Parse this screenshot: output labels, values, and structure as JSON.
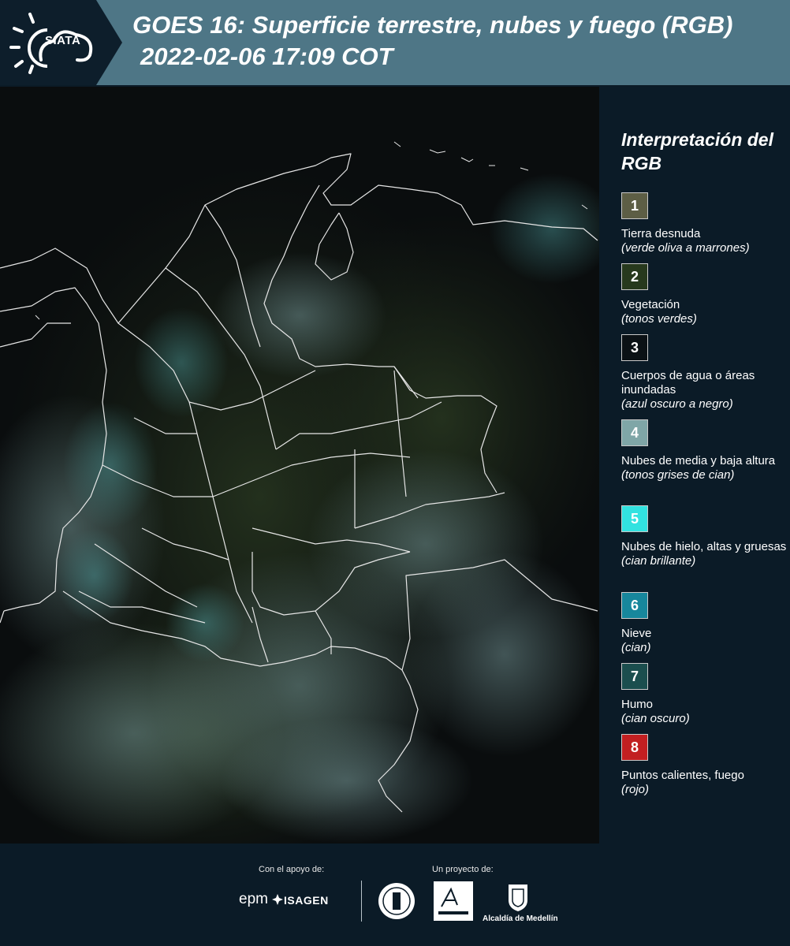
{
  "header": {
    "logo_text": "SIATA",
    "title": "GOES 16: Superficie terrestre, nubes y fuego (RGB)",
    "subtitle": "2022-02-06 17:09 COT",
    "colors": {
      "bar": "#4e7686",
      "logo_block": "#0d1e2b"
    }
  },
  "map": {
    "description_icon": "satellite-rgb-map",
    "colors": {
      "background": "#0a0d0e",
      "vegetation": "#1c2a1a",
      "cloud": "#5a7a7c",
      "border": "#e6e6e6"
    }
  },
  "legend": {
    "title": "Interpretación del RGB",
    "items": [
      {
        "number": "1",
        "label": "Tierra desnuda",
        "desc": "(verde oliva a marrones)",
        "color": "#5d5e45"
      },
      {
        "number": "2",
        "label": "Vegetación",
        "desc": "(tonos verdes)",
        "color": "#27391d"
      },
      {
        "number": "3",
        "label": "Cuerpos de agua o áreas inundadas",
        "desc": "(azul oscuro a negro)",
        "color": "#0b1115"
      },
      {
        "number": "4",
        "label": "Nubes de media y baja altura",
        "desc": "(tonos grises de cian)",
        "color": "#7fa6a7"
      },
      {
        "number": "5",
        "label": "Nubes de hielo, altas y gruesas",
        "desc": "(cian brillante)",
        "color": "#32e2e0"
      },
      {
        "number": "6",
        "label": "Nieve",
        "desc": "(cian)",
        "color": "#17879c"
      },
      {
        "number": "7",
        "label": "Humo",
        "desc": "(cian oscuro)",
        "color": "#1b4e4e"
      },
      {
        "number": "8",
        "label": "Puntos calientes, fuego",
        "desc": "(rojo)",
        "color": "#c21f21"
      }
    ]
  },
  "footer": {
    "support_label": "Con el apoyo de:",
    "project_label": "Un proyecto de:",
    "epm": "epm",
    "isagen": "ISAGEN",
    "alcaldia": "Alcaldía de Medellín"
  }
}
